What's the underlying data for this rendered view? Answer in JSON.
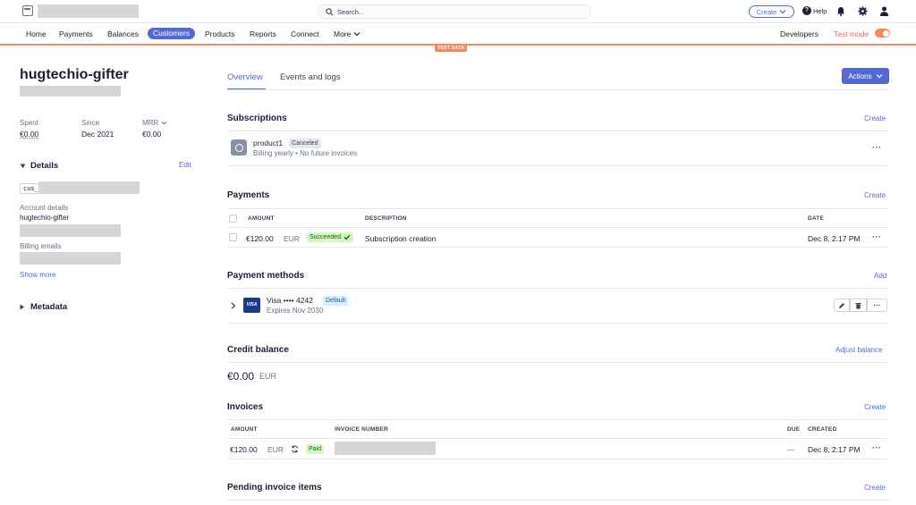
{
  "topbar": {
    "search_placeholder": "Search...",
    "create_label": "Create",
    "help_label": "Help"
  },
  "nav": {
    "items": [
      "Home",
      "Payments",
      "Balances",
      "Customers",
      "Products",
      "Reports",
      "Connect",
      "More"
    ],
    "developers_label": "Developers",
    "test_mode_label": "Test mode",
    "test_data_banner": "TEST DATA"
  },
  "customer": {
    "name": "hugtechio-gifter",
    "stats": [
      {
        "label": "Spent",
        "value": "€0.00"
      },
      {
        "label": "Since",
        "value": "Dec 2021"
      },
      {
        "label": "MRR",
        "value": "€0.00"
      }
    ],
    "details_title": "Details",
    "edit_label": "Edit",
    "id_prefix": "cus_",
    "account_details_label": "Account details",
    "account_details_value": "hugtechio-gifter",
    "billing_emails_label": "Billing emails",
    "show_more_label": "Show more",
    "metadata_title": "Metadata"
  },
  "tabs": {
    "overview": "Overview",
    "events": "Events and logs",
    "actions_label": "Actions"
  },
  "subscriptions": {
    "title": "Subscriptions",
    "create_label": "Create",
    "product_name": "product1",
    "status": "Canceled",
    "detail": "Billing yearly • No future invoices"
  },
  "payments": {
    "title": "Payments",
    "create_label": "Create",
    "columns": {
      "amount": "AMOUNT",
      "description": "DESCRIPTION",
      "date": "DATE"
    },
    "row": {
      "amount": "€120.00",
      "currency": "EUR",
      "status": "Succeeded",
      "description": "Subscription creation",
      "date": "Dec 8, 2:17 PM"
    }
  },
  "payment_methods": {
    "title": "Payment methods",
    "add_label": "Add",
    "card_brand_logo": "VISA",
    "card_label": "Visa •••• 4242",
    "default_badge": "Default",
    "expires": "Expires Nov 2030"
  },
  "credit_balance": {
    "title": "Credit balance",
    "adjust_label": "Adjust balance",
    "amount": "€0.00",
    "currency": "EUR"
  },
  "invoices": {
    "title": "Invoices",
    "create_label": "Create",
    "columns": {
      "amount": "AMOUNT",
      "number": "INVOICE NUMBER",
      "due": "DUE",
      "created": "CREATED"
    },
    "row": {
      "amount": "€120.00",
      "currency": "EUR",
      "status": "Paid",
      "due": "—",
      "created": "Dec 8, 2:17 PM"
    }
  },
  "pending": {
    "title": "Pending invoice items",
    "create_label": "Create"
  },
  "colors": {
    "accent": "#5469d4",
    "test_orange": "#f5895a"
  }
}
